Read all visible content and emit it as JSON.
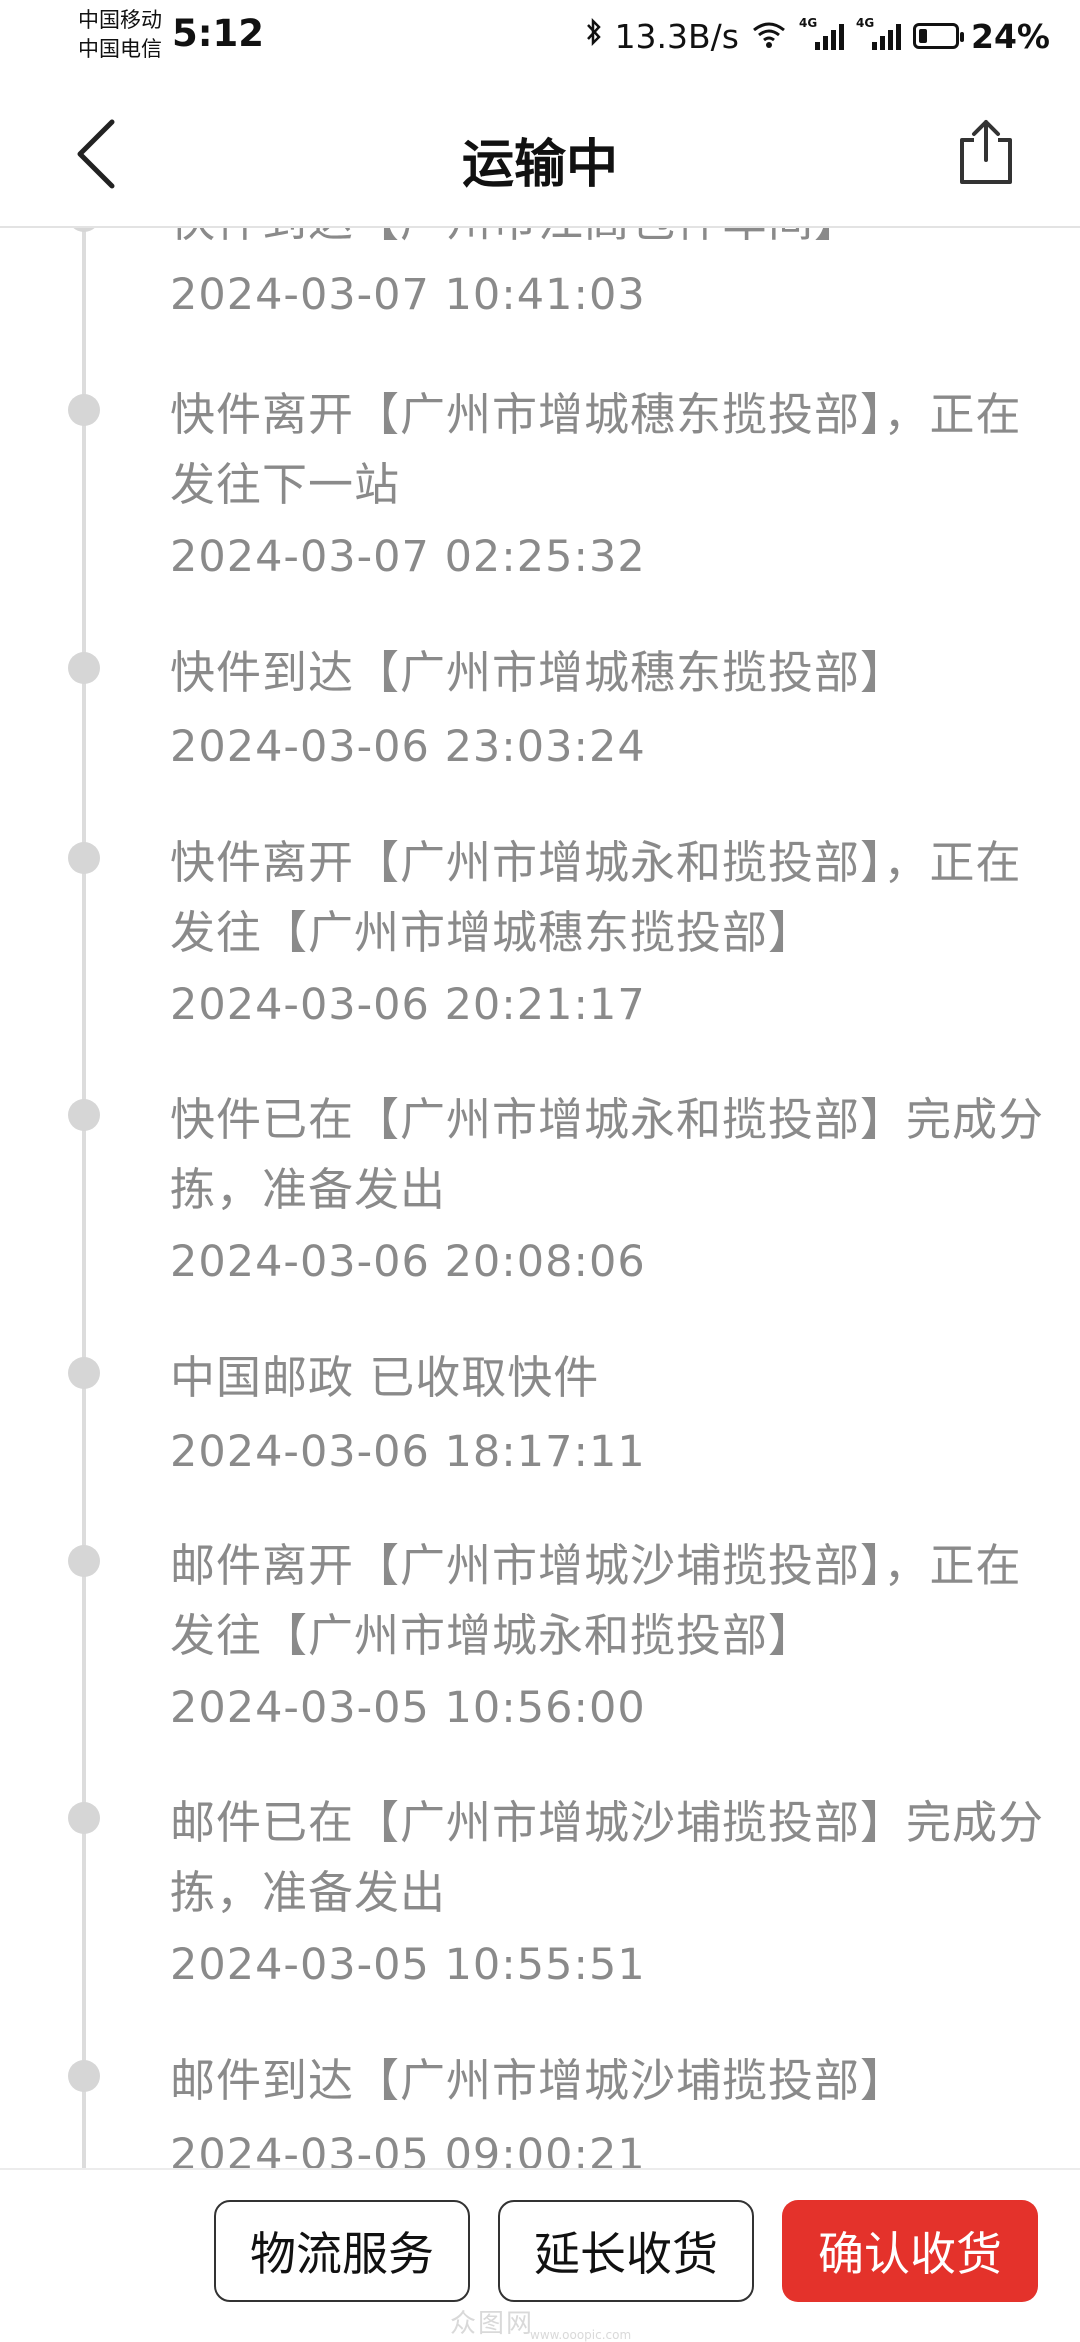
{
  "status_bar": {
    "carrier1": "中国移动",
    "carrier2": "中国电信",
    "time": "5:12",
    "net_speed": "13.3B/s",
    "signal_tag": "4G",
    "battery": "24%",
    "battery_level": 0.24
  },
  "header": {
    "title": "运输中",
    "back_icon": "chevron-left-icon",
    "share_icon": "share-icon"
  },
  "timeline": [
    {
      "text": "快件到达【广州市江高包件车间】",
      "time": "2024-03-07 10:41:03"
    },
    {
      "text": "快件离开【广州市增城穗东揽投部】，正在发往下一站",
      "time": "2024-03-07 02:25:32"
    },
    {
      "text": "快件到达【广州市增城穗东揽投部】",
      "time": "2024-03-06 23:03:24"
    },
    {
      "text": "快件离开【广州市增城永和揽投部】，正在发往【广州市增城穗东揽投部】",
      "time": "2024-03-06 20:21:17"
    },
    {
      "text": "快件已在【广州市增城永和揽投部】完成分拣，准备发出",
      "time": "2024-03-06 20:08:06"
    },
    {
      "text": "中国邮政 已收取快件",
      "time": "2024-03-06 18:17:11"
    },
    {
      "text": "邮件离开【广州市增城沙埔揽投部】，正在发往【广州市增城永和揽投部】",
      "time": "2024-03-05 10:56:00"
    },
    {
      "text": "邮件已在【广州市增城沙埔揽投部】完成分拣，准备发出",
      "time": "2024-03-05 10:55:51"
    },
    {
      "text": "邮件到达【广州市增城沙埔揽投部】",
      "time": "2024-03-05 09:00:21"
    }
  ],
  "bottom_bar": {
    "logistics_service": "物流服务",
    "extend_receipt": "延长收货",
    "confirm_receipt": "确认收货",
    "watermark": "众图网",
    "watermark_url": "www.ooopic.com"
  },
  "colors": {
    "primary": "#e4322b",
    "timeline_text": "#8a8a8a",
    "divider": "#e3e3e3"
  }
}
